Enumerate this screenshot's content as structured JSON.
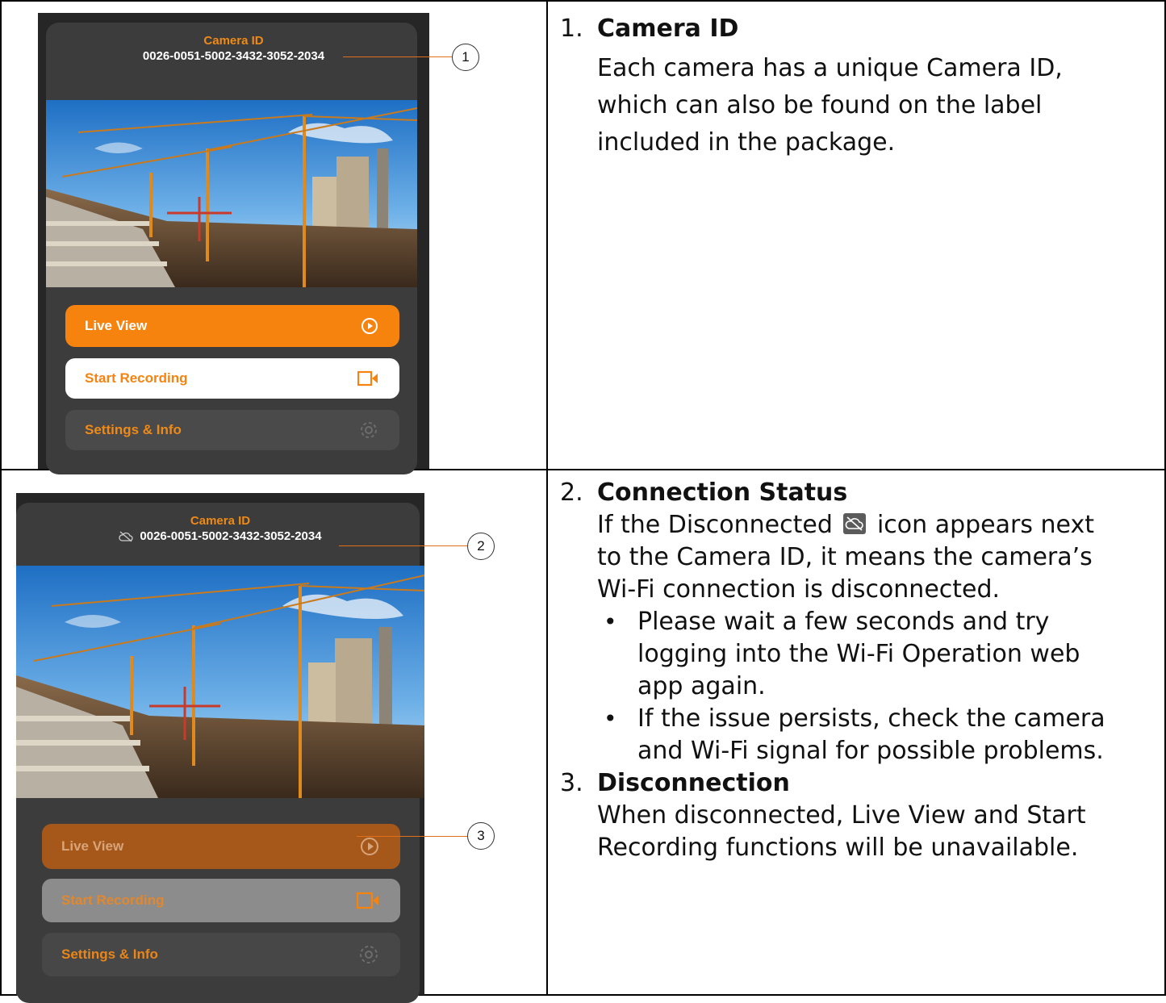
{
  "panels": [
    {
      "camera_label": "Camera ID",
      "camera_id": "0026-0051-5002-3432-3052-2034",
      "show_disconnected_icon": false,
      "buttons": {
        "live_view": "Live View",
        "start_recording": "Start Recording",
        "settings": "Settings & Info"
      },
      "callouts": [
        "1"
      ]
    },
    {
      "camera_label": "Camera ID",
      "camera_id": "0026-0051-5002-3432-3052-2034",
      "show_disconnected_icon": true,
      "buttons": {
        "live_view": "Live View",
        "start_recording": "Start Recording",
        "settings": "Settings & Info"
      },
      "callouts": [
        "2",
        "3"
      ]
    }
  ],
  "descriptions": {
    "item1": {
      "number": "1.",
      "title": "Camera ID",
      "body": "Each camera has a unique Camera ID, which can also be found on the label included in the package."
    },
    "item2": {
      "number": "2.",
      "title": "Connection Status",
      "body_before_icon": "If the Disconnected",
      "body_after_icon": "icon appears next to the Camera ID, it means the camera’s Wi-Fi connection is disconnected.",
      "bullets": [
        "Please wait a few seconds and try logging into the Wi-Fi Operation web app again.",
        "If the issue persists, check the camera and Wi-Fi signal for possible problems."
      ]
    },
    "item3": {
      "number": "3.",
      "title": "Disconnection",
      "body": "When disconnected, Live View and Start Recording functions will be unavailable."
    }
  },
  "colors": {
    "accent_orange": "#f7830f",
    "dark_bg": "#262626",
    "card_bg": "#3c3c3c"
  },
  "icons": {
    "play": "play-circle-icon",
    "record": "video-camera-icon",
    "settings": "gear-icon",
    "disconnected": "cloud-off-icon"
  }
}
